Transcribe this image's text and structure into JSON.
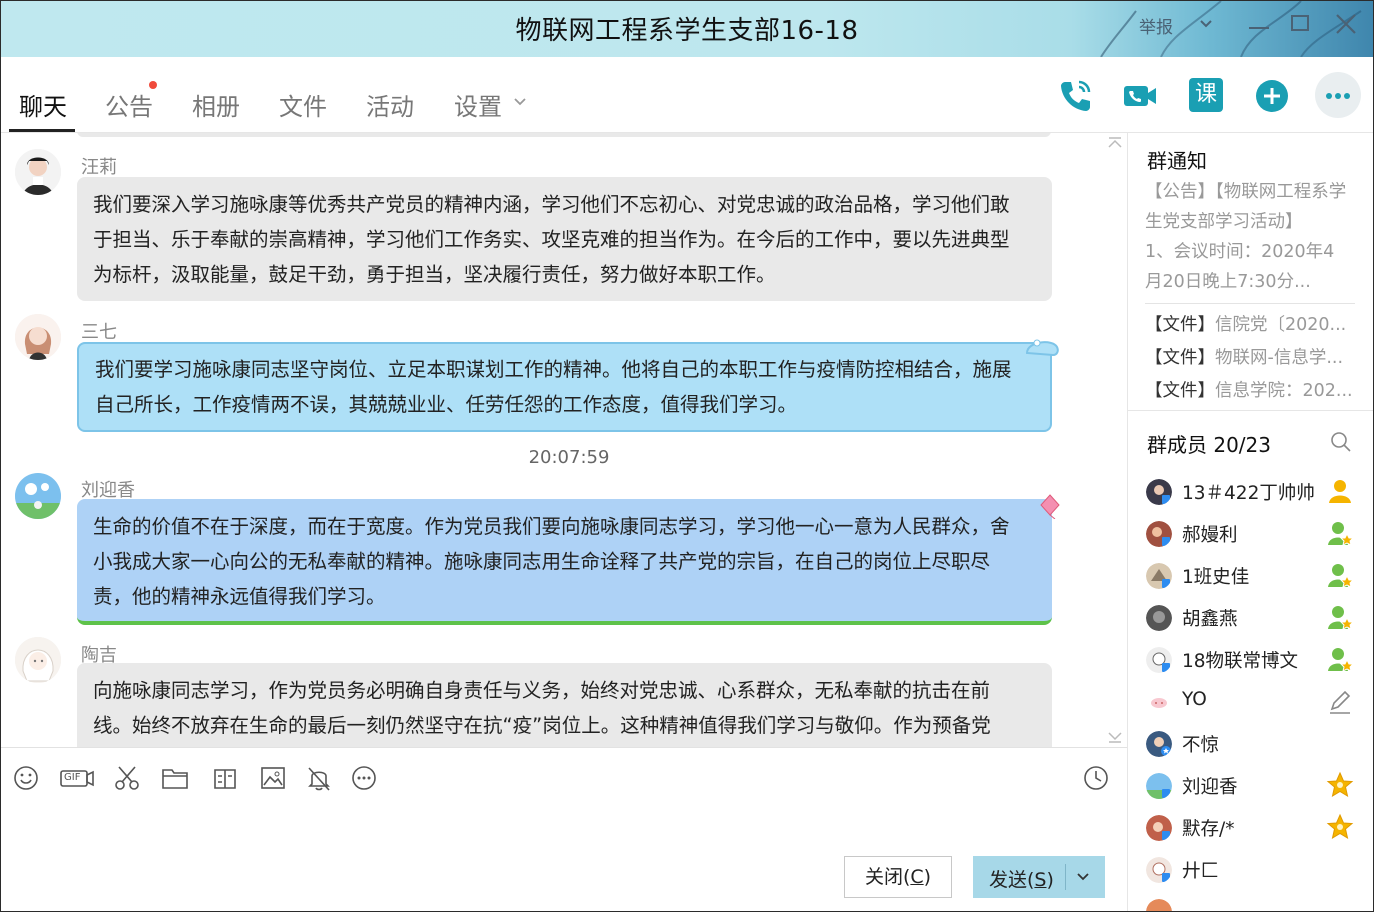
{
  "window": {
    "title": "物联网工程系学生支部16-18",
    "report_label": "举报"
  },
  "tabs": [
    {
      "label": "聊天",
      "active": true
    },
    {
      "label": "公告",
      "has_dot": true
    },
    {
      "label": "相册"
    },
    {
      "label": "文件"
    },
    {
      "label": "活动"
    },
    {
      "label": "设置"
    }
  ],
  "header_icons": [
    "phone-icon",
    "video-call-icon",
    "class-icon",
    "add-app-icon",
    "more-icon"
  ],
  "header": {
    "class_glyph": "课"
  },
  "messages": [
    {
      "sender": "汪莉",
      "lines": [
        "我们要深入学习施咏康等优秀共产党员的精神内涵，学习他们不忘初心、对党忠诚的政治品格，学习他们敢",
        "于担当、乐于奉献的崇高精神，学习他们工作务实、攻坚克难的担当作为。在今后的工作中，要以先进典型",
        "为标杆，汲取能量，鼓足干劲，勇于担当，坚决履行责任，努力做好本职工作。"
      ]
    },
    {
      "sender": "三七",
      "lines": [
        "我们要学习施咏康同志坚守岗位、立足本职谋划工作的精神。他将自己的本职工作与疫情防控相结合，施展",
        "自己所长，工作疫情两不误，其兢兢业业、任劳任怨的工作态度，值得我们学习。"
      ]
    },
    {
      "sender": "刘迎香",
      "lines": [
        "生命的价值不在于深度，而在于宽度。作为党员我们要向施咏康同志学习，学习他一心一意为人民群众，舍",
        "小我成大家一心向公的无私奉献的精神。施咏康同志用生命诠释了共产党的宗旨，在自己的岗位上尽职尽",
        "责，他的精神永远值得我们学习。"
      ]
    },
    {
      "sender": "陶吉",
      "lines": [
        "向施咏康同志学习，作为党员务必明确自身责任与义务，始终对党忠诚、心系群众，无私奉献的抗击在前",
        "线。始终不放弃在生命的最后一刻仍然坚守在抗“疫”岗位上。这种精神值得我们学习与敬仰。作为预备党"
      ]
    }
  ],
  "timestamp": "20:07:59",
  "toolbar": [
    "emoji-icon",
    "gif-icon",
    "scissors-icon",
    "folder-icon",
    "sticker-icon",
    "image-icon",
    "mute-bell-icon",
    "more-options-icon",
    "history-clock-icon"
  ],
  "toolbar_gif_label": "GIF",
  "buttons": {
    "close_label": "关闭(",
    "close_key": "C",
    "close_end": ")",
    "send_label": "发送(",
    "send_key": "S",
    "send_end": ")"
  },
  "notice": {
    "title": "群通知",
    "lines": [
      "【公告】【物联网工程系学",
      "生党支部学习活动】",
      "1、会议时间：2020年4",
      "月20日晚上7:30分..."
    ],
    "files": [
      {
        "tag": "【文件】",
        "name": "信院党〔2020..."
      },
      {
        "tag": "【文件】",
        "name": "物联网-信息学..."
      },
      {
        "tag": "【文件】",
        "name": "信息学院：202..."
      }
    ]
  },
  "members": {
    "title": "群成员 20/23",
    "list": [
      {
        "name": "13＃422丁帅帅",
        "badge": "owner-icon"
      },
      {
        "name": "郝嫚利",
        "badge": "admin-icon"
      },
      {
        "name": "1班史佳",
        "badge": "admin-icon"
      },
      {
        "name": "胡鑫燕",
        "badge": "admin-icon"
      },
      {
        "name": "18物联常博文",
        "badge": "admin-icon"
      },
      {
        "name": "YO",
        "badge": "edit-icon"
      },
      {
        "name": "不惊",
        "badge": ""
      },
      {
        "name": "刘迎香",
        "badge": "star-icon"
      },
      {
        "name": "默存/*",
        "badge": "star-icon"
      },
      {
        "name": "廾匚",
        "badge": ""
      }
    ]
  },
  "colors": {
    "accent": "#1a9fb3",
    "blue_bubble": "#aee0f7",
    "grey_bubble": "#e9e9e9",
    "star": "#f5b400"
  }
}
